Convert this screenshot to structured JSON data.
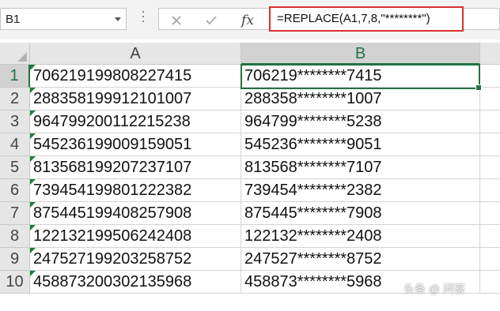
{
  "formula_bar": {
    "name_box": "B1",
    "cancel_icon": "close-icon",
    "enter_icon": "check-icon",
    "fx_label": "fx",
    "formula": "=REPLACE(A1,7,8,\"********\")"
  },
  "columns": [
    {
      "label": "A"
    },
    {
      "label": "B"
    }
  ],
  "rows": [
    {
      "num": "1",
      "a": "706219199808227415",
      "b": "706219********7415"
    },
    {
      "num": "2",
      "a": "288358199912101007",
      "b": "288358********1007"
    },
    {
      "num": "3",
      "a": "964799200112215238",
      "b": "964799********5238"
    },
    {
      "num": "4",
      "a": "545236199009159051",
      "b": "545236********9051"
    },
    {
      "num": "5",
      "a": "813568199207237107",
      "b": "813568********7107"
    },
    {
      "num": "6",
      "a": "739454199801222382",
      "b": "739454********2382"
    },
    {
      "num": "7",
      "a": "875445199408257908",
      "b": "875445********7908"
    },
    {
      "num": "8",
      "a": "122132199506242408",
      "b": "122132********2408"
    },
    {
      "num": "9",
      "a": "247527199203258752",
      "b": "247527********8752"
    },
    {
      "num": "10",
      "a": "458873200302135968",
      "b": "458873********5968"
    }
  ],
  "selected_cell": "B1",
  "watermark": "头条 @ 问答",
  "colors": {
    "excel_green": "#217346",
    "highlight_red": "#d9312b",
    "header_gray": "#e6e6e6"
  }
}
